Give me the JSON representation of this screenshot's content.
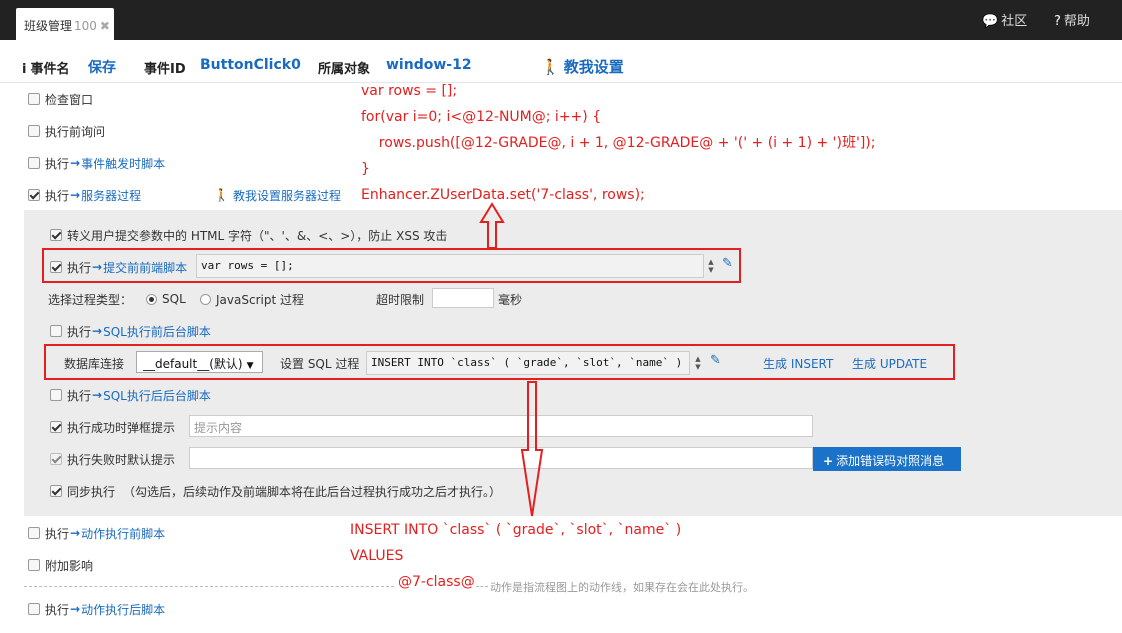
{
  "tab": {
    "title": "班级管理",
    "count": "100",
    "close": "✖"
  },
  "topnav": {
    "community": "社区",
    "help": "帮助"
  },
  "event": {
    "name_label": "事件名",
    "name_value": "保存",
    "id_label": "事件ID",
    "id_value": "ButtonClick0",
    "owner_label": "所属对象",
    "owner_value": "window-12",
    "teach": "教我设置"
  },
  "options": {
    "check_window": "检查窗口",
    "confirm_before": "执行前询问",
    "exec": "执行",
    "trigger_script": "事件触发时脚本",
    "server_proc": "服务器过程",
    "teach_server": "教我设置服务器过程",
    "before_action": "动作执行前脚本",
    "side_effect": "附加影响",
    "after_action": "动作执行后脚本",
    "action_note": "动作是指流程图上的动作线，如果存在会在此处执行。"
  },
  "panel": {
    "escape_html": "转义用户提交参数中的 HTML 字符（\"、'、&、<、>），防止 XSS 攻击",
    "exec": "执行",
    "pre_submit": "提交前前端脚本",
    "pre_submit_code": "var rows = [];",
    "proc_type_label": "选择过程类型：",
    "sql": "SQL",
    "js_proc": "JavaScript 过程",
    "timeout_label": "超时限制",
    "timeout_value": "",
    "ms": "毫秒",
    "sql_before": "SQL执行前后台脚本",
    "db_label": "数据库连接",
    "db_value": "__default__(默认)",
    "sql_proc_label": "设置 SQL 过程",
    "sql_code": "INSERT INTO `class` ( `grade`, `slot`, `name` )",
    "gen_insert": "生成 INSERT",
    "gen_update": "生成 UPDATE",
    "sql_after": "SQL执行后后台脚本",
    "success_popup": "执行成功时弹框提示",
    "success_placeholder": "提示内容",
    "fail_default": "执行失败时默认提示",
    "fail_value": "",
    "add_error_btn": "添加错误码对照消息",
    "sync_exec": "同步执行",
    "sync_note": "（勾选后，后续动作及前端脚本将在此后台过程执行成功之后才执行。）"
  },
  "annotation_js": [
    "var rows = [];",
    "for(var i=0; i<@12-NUM@; i++) {",
    "    rows.push([@12-GRADE@, i + 1, @12-GRADE@ + '(' + (i + 1) + ')班']);",
    "}",
    "Enhancer.ZUserData.set('7-class', rows);"
  ],
  "annotation_sql": [
    "INSERT INTO `class` ( `grade`, `slot`, `name` )",
    "VALUES",
    "@7-class@"
  ],
  "colors": {
    "accent": "#1a6bbf",
    "highlight": "#e3201f",
    "topbar": "#222222"
  }
}
